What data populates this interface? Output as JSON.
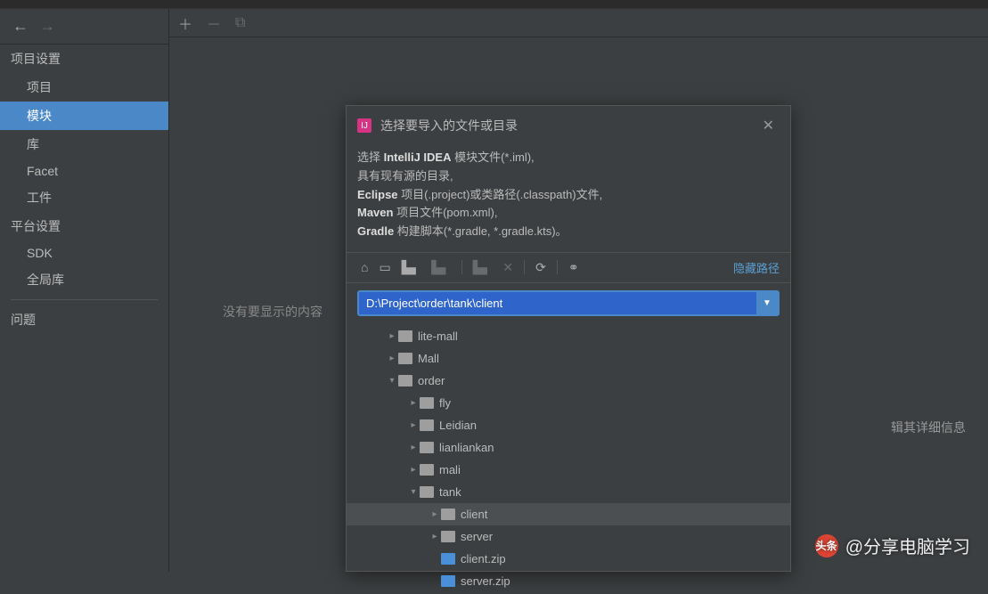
{
  "sidebar": {
    "section1": "项目设置",
    "items1": [
      "项目",
      "模块",
      "库",
      "Facet",
      "工件"
    ],
    "selected1": 1,
    "section2": "平台设置",
    "items2": [
      "SDK",
      "全局库"
    ],
    "section3": "问题"
  },
  "main": {
    "empty": "没有要显示的内容",
    "detail": "辑其详细信息"
  },
  "dialog": {
    "title": "选择要导入的文件或目录",
    "desc_line1_a": "选择 ",
    "desc_line1_b": "IntelliJ IDEA",
    "desc_line1_c": " 模块文件(*.iml),",
    "desc_line2": "具有现有源的目录,",
    "desc_line3_a": "Eclipse",
    "desc_line3_b": " 项目(.project)或类路径(.classpath)文件,",
    "desc_line4_a": "Maven",
    "desc_line4_b": " 项目文件(pom.xml),",
    "desc_line5_a": "Gradle",
    "desc_line5_b": " 构建脚本(*.gradle, *.gradle.kts)。",
    "hide_path": "隐藏路径",
    "path": "D:\\Project\\order\\tank\\client",
    "tree": [
      {
        "indent": 44,
        "arrow": "▸",
        "type": "folder",
        "label": "lite-mall"
      },
      {
        "indent": 44,
        "arrow": "▸",
        "type": "folder",
        "label": "Mall"
      },
      {
        "indent": 44,
        "arrow": "▾",
        "type": "folder-open",
        "label": "order"
      },
      {
        "indent": 68,
        "arrow": "▸",
        "type": "folder",
        "label": "fly"
      },
      {
        "indent": 68,
        "arrow": "▸",
        "type": "folder",
        "label": "Leidian"
      },
      {
        "indent": 68,
        "arrow": "▸",
        "type": "folder",
        "label": "lianliankan"
      },
      {
        "indent": 68,
        "arrow": "▸",
        "type": "folder",
        "label": "mali"
      },
      {
        "indent": 68,
        "arrow": "▾",
        "type": "folder-open",
        "label": "tank"
      },
      {
        "indent": 92,
        "arrow": "▸",
        "type": "folder",
        "label": "client",
        "selected": true
      },
      {
        "indent": 92,
        "arrow": "▸",
        "type": "folder",
        "label": "server"
      },
      {
        "indent": 92,
        "arrow": "",
        "type": "zip",
        "label": "client.zip"
      },
      {
        "indent": 92,
        "arrow": "",
        "type": "zip",
        "label": "server.zip"
      }
    ]
  },
  "watermark": {
    "prefix": "头条",
    "text": "@分享电脑学习"
  }
}
